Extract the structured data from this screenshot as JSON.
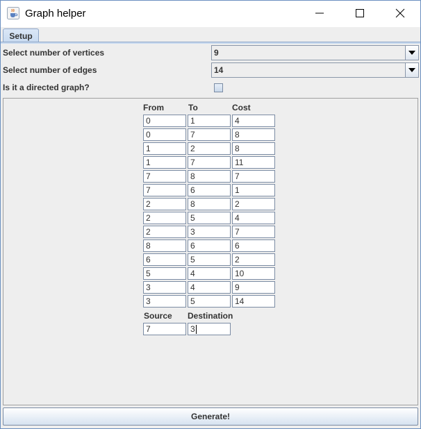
{
  "window": {
    "title": "Graph helper"
  },
  "tabs": [
    {
      "label": "Setup"
    }
  ],
  "setup": {
    "vertices_label": "Select number of vertices",
    "vertices_value": "9",
    "edges_label": "Select number of edges",
    "edges_value": "14",
    "directed_label": "Is it a directed graph?",
    "directed_checked": false
  },
  "edge_table": {
    "headers": {
      "from": "From",
      "to": "To",
      "cost": "Cost"
    },
    "rows": [
      {
        "from": "0",
        "to": "1",
        "cost": "4"
      },
      {
        "from": "0",
        "to": "7",
        "cost": "8"
      },
      {
        "from": "1",
        "to": "2",
        "cost": "8"
      },
      {
        "from": "1",
        "to": "7",
        "cost": "11"
      },
      {
        "from": "7",
        "to": "8",
        "cost": "7"
      },
      {
        "from": "7",
        "to": "6",
        "cost": "1"
      },
      {
        "from": "2",
        "to": "8",
        "cost": "2"
      },
      {
        "from": "2",
        "to": "5",
        "cost": "4"
      },
      {
        "from": "2",
        "to": "3",
        "cost": "7"
      },
      {
        "from": "8",
        "to": "6",
        "cost": "6"
      },
      {
        "from": "6",
        "to": "5",
        "cost": "2"
      },
      {
        "from": "5",
        "to": "4",
        "cost": "10"
      },
      {
        "from": "3",
        "to": "4",
        "cost": "9"
      },
      {
        "from": "3",
        "to": "5",
        "cost": "14"
      }
    ]
  },
  "route": {
    "source_label": "Source",
    "destination_label": "Destination",
    "source_value": "7",
    "destination_value": "3"
  },
  "generate_label": "Generate!",
  "icons": {
    "app": "java-cup-icon",
    "minimize": "minimize-icon",
    "maximize": "maximize-icon",
    "close": "close-icon",
    "dropdown": "chevron-down-icon"
  }
}
